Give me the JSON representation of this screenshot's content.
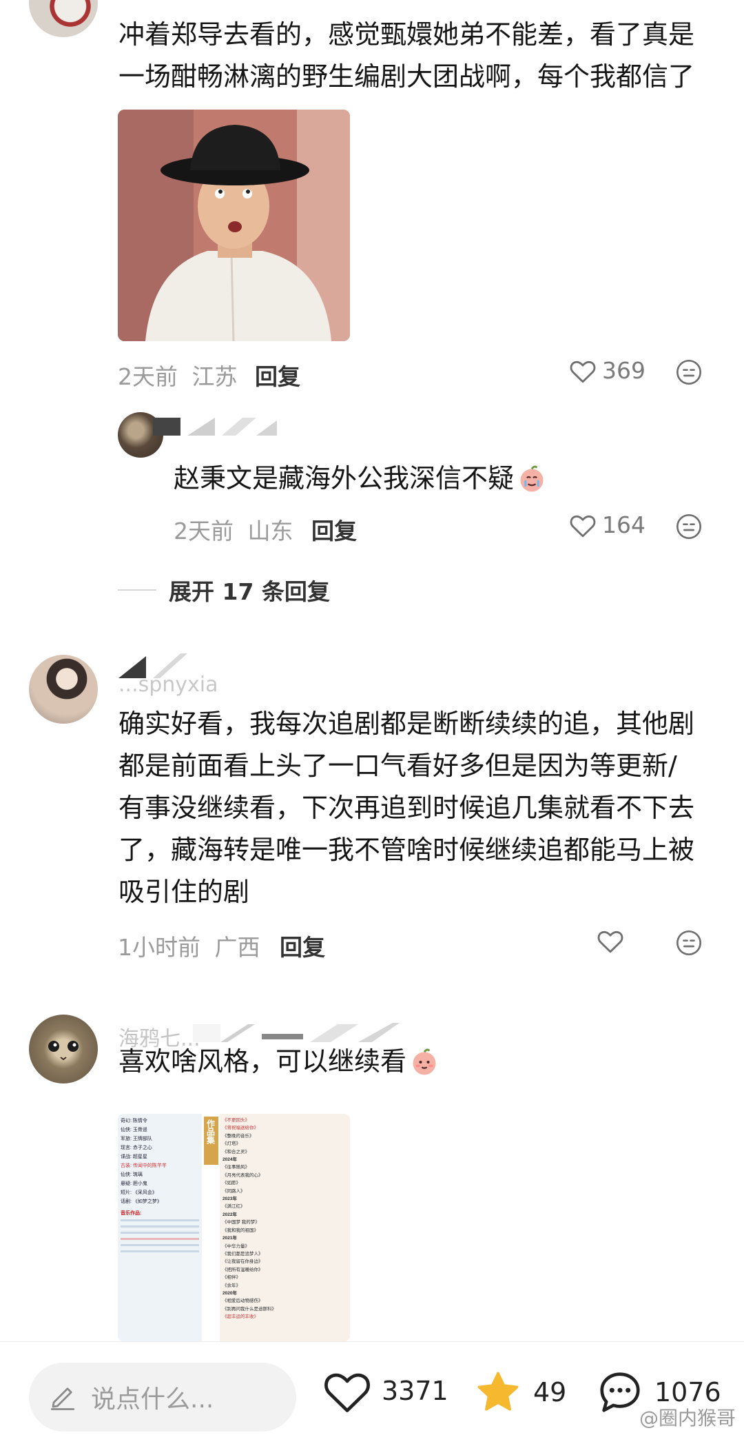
{
  "comments": [
    {
      "text_line1": "冲着郑导去看的，感觉甄嬛她弟不能差，看了真是",
      "text_line2": "一场酣畅淋漓的野生编剧大团战啊，每个我都信了",
      "time": "2天前",
      "location": "江苏",
      "reply_label": "回复",
      "likes": "369"
    },
    {
      "text": "赵秉文是藏海外公我深信不疑",
      "emoji": "crying-peach-emoji",
      "time": "2天前",
      "location": "山东",
      "reply_label": "回复",
      "likes": "164"
    },
    {
      "username": "...spnyxia",
      "text_lines": [
        "确实好看，我每次追剧都是断断续续的追，其他剧",
        "都是前面看上头了一口气看好多但是因为等更新/",
        "有事没继续看，下次再追到时候追几集就看不下去",
        "了，藏海转是唯一我不管啥时候继续追都能马上被",
        "吸引住的剧"
      ],
      "time": "1小时前",
      "location": "广西",
      "reply_label": "回复"
    },
    {
      "username": "海鸦七...",
      "text": "喜欢啥风格，可以继续看",
      "emoji": "shy-peach-emoji",
      "poster_title": "作品集",
      "poster_left_lines": [
        "奇幻: 陈情令",
        "仙侠: 玉骨遥",
        "军旅: 王牌部队",
        "现言: 赤子之心",
        "谍战: 超星星",
        "古装: 传闻中的陈芊芊",
        "仙侠: 琉璃",
        "悬疑: 胆小鬼",
        "短片: 《采风会》",
        "话剧: 《如梦之梦》"
      ],
      "poster_music_title": "音乐作品:",
      "poster_right_lines": [
        "《不更回头》",
        "《将祝福送给你》",
        "《整晚的音乐》",
        "《灯塔》",
        "《和合之灵》",
        "2024年",
        "《往事随风》",
        "《月亮代表我的心》",
        "《如愿》",
        "《同路人》",
        "2023年",
        "《满江红》",
        "2022年",
        "《中国梦 我的梦》",
        "《我和我的祖国》",
        "2021年",
        "《中华力量》",
        "《我们都是追梦人》",
        "《让我留在你身边》",
        "《把所有温暖给你》",
        "《相伴》",
        "《余年》",
        "2020年",
        "《相爱后动物感伤》",
        "《别再问我什么是迪斯科》",
        "《超丰运的丰收》"
      ]
    }
  ],
  "thread": {
    "expand_label": "展开 17 条回复"
  },
  "bottom_bar": {
    "input_placeholder": "说点什么...",
    "likes": "3371",
    "favorites": "49",
    "comments": "1076"
  },
  "watermark": "@圈内猴哥",
  "colors": {
    "star": "#f5b82e",
    "muted": "#9a9a9a"
  }
}
